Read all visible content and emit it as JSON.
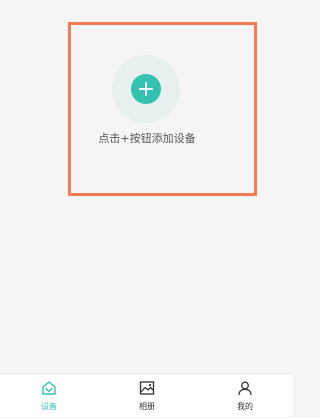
{
  "main": {
    "hint_text": "点击+按钮添加设备",
    "add_icon": "plus-icon"
  },
  "tabbar": {
    "active_index": 0,
    "tabs": [
      {
        "label": "设备",
        "icon": "device-icon"
      },
      {
        "label": "相册",
        "icon": "album-icon"
      },
      {
        "label": "我的",
        "icon": "user-icon"
      }
    ]
  },
  "colors": {
    "accent": "#33c2b0",
    "highlight_border": "#f47b52",
    "background": "#f5f5f5",
    "halo": "#e6f1ef",
    "text": "#555555",
    "tab_text": "#333333"
  }
}
